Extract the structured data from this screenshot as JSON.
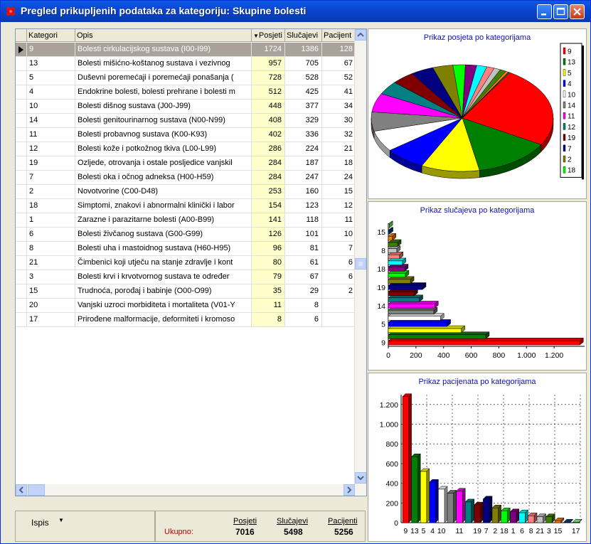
{
  "window": {
    "title": "Pregled prikupljenih podataka za kategoriju: Skupine bolesti"
  },
  "table": {
    "columns": {
      "kategorija": "Kategori",
      "opis": "Opis",
      "posjeti": "Posjeti",
      "slucajevi": "Slučajevi",
      "pacijenti": "Pacijent"
    },
    "rows": [
      {
        "kategorija": "9",
        "opis": "Bolesti cirkulacijskog sustava (I00-I99)",
        "posjeti": "1724",
        "slucajevi": "1386",
        "pacijenti": "128"
      },
      {
        "kategorija": "13",
        "opis": "Bolesti mišićno-koštanog sustava i vezivnog",
        "posjeti": "957",
        "slucajevi": "705",
        "pacijenti": "67"
      },
      {
        "kategorija": "5",
        "opis": "Duševni poremećaji i poremećaji ponašanja (",
        "posjeti": "728",
        "slucajevi": "528",
        "pacijenti": "52"
      },
      {
        "kategorija": "4",
        "opis": "Endokrine bolesti, bolesti prehrane i bolesti m",
        "posjeti": "512",
        "slucajevi": "425",
        "pacijenti": "41"
      },
      {
        "kategorija": "10",
        "opis": "Bolesti dišnog sustava (J00-J99)",
        "posjeti": "448",
        "slucajevi": "377",
        "pacijenti": "34"
      },
      {
        "kategorija": "14",
        "opis": "Bolesti genitourinarnog sustava (N00-N99)",
        "posjeti": "408",
        "slucajevi": "329",
        "pacijenti": "30"
      },
      {
        "kategorija": "11",
        "opis": "Bolesti probavnog sustava (K00-K93)",
        "posjeti": "402",
        "slucajevi": "336",
        "pacijenti": "32"
      },
      {
        "kategorija": "12",
        "opis": "Bolesti kože i potkožnog tkiva (L00-L99)",
        "posjeti": "286",
        "slucajevi": "224",
        "pacijenti": "21"
      },
      {
        "kategorija": "19",
        "opis": "Ozljede, otrovanja i ostale posljedice vanjskil",
        "posjeti": "284",
        "slucajevi": "187",
        "pacijenti": "18"
      },
      {
        "kategorija": "7",
        "opis": "Bolesti oka i očnog adneksa (H00-H59)",
        "posjeti": "284",
        "slucajevi": "247",
        "pacijenti": "24"
      },
      {
        "kategorija": "2",
        "opis": "Novotvorine (C00-D48)",
        "posjeti": "253",
        "slucajevi": "160",
        "pacijenti": "15"
      },
      {
        "kategorija": "18",
        "opis": "Simptomi, znakovi i abnormalni klinički i labor",
        "posjeti": "154",
        "slucajevi": "123",
        "pacijenti": "12"
      },
      {
        "kategorija": "1",
        "opis": "Zarazne i parazitarne bolesti (A00-B99)",
        "posjeti": "141",
        "slucajevi": "118",
        "pacijenti": "11"
      },
      {
        "kategorija": "6",
        "opis": "Bolesti živčanog sustava (G00-G99)",
        "posjeti": "126",
        "slucajevi": "101",
        "pacijenti": "10"
      },
      {
        "kategorija": "8",
        "opis": "Bolesti uha i mastoidnog sustava (H60-H95)",
        "posjeti": "96",
        "slucajevi": "81",
        "pacijenti": "7"
      },
      {
        "kategorija": "21",
        "opis": "Čimbenici koji utječu na stanje zdravlje i kont",
        "posjeti": "80",
        "slucajevi": "61",
        "pacijenti": "6"
      },
      {
        "kategorija": "3",
        "opis": "Bolesti krvi i krvotvornog sustava te određer",
        "posjeti": "79",
        "slucajevi": "67",
        "pacijenti": "6"
      },
      {
        "kategorija": "15",
        "opis": "Trudnoća, porođaj i babinje (O00-O99)",
        "posjeti": "35",
        "slucajevi": "29",
        "pacijenti": "2"
      },
      {
        "kategorija": "20",
        "opis": "Vanjski uzroci morbiditeta i mortaliteta (V01-Y",
        "posjeti": "11",
        "slucajevi": "8",
        "pacijenti": ""
      },
      {
        "kategorija": "17",
        "opis": "Prirođene malformacije, deformiteti i kromoso",
        "posjeti": "8",
        "slucajevi": "6",
        "pacijenti": ""
      }
    ]
  },
  "footer": {
    "ispis_label": "Ispis",
    "ukupno_label": "Ukupno:",
    "posjeti_label": "Posjeti",
    "posjeti_value": "7016",
    "slucajevi_label": "Slučajevi",
    "slucajevi_value": "5498",
    "pacijenti_label": "Pacijenti",
    "pacijenti_value": "5256"
  },
  "colors": {
    "9": "#ff0000",
    "13": "#008000",
    "5": "#ffff00",
    "4": "#0000ff",
    "10": "#ffffff",
    "14": "#808080",
    "11": "#ff00ff",
    "12": "#008080",
    "19": "#800000",
    "7": "#000080",
    "2": "#808000",
    "18": "#00ff00",
    "1": "#800080",
    "6": "#00ffff",
    "8": "#ff8080",
    "21": "#c0c0c0",
    "3": "#408000",
    "15": "#ff8000",
    "20": "#004080",
    "17": "#80ff80"
  },
  "chart_data": [
    {
      "type": "pie",
      "title": "Prikaz posjeta po kategorijama",
      "categories": [
        "9",
        "13",
        "5",
        "4",
        "10",
        "14",
        "11",
        "12",
        "19",
        "7",
        "2",
        "18",
        "1",
        "6",
        "8",
        "21",
        "3",
        "15",
        "20",
        "17"
      ],
      "values": [
        1724,
        957,
        728,
        512,
        448,
        408,
        402,
        286,
        284,
        284,
        253,
        154,
        141,
        126,
        96,
        80,
        79,
        35,
        11,
        8
      ],
      "legend": [
        "9",
        "13",
        "5",
        "4",
        "10",
        "14",
        "11",
        "12",
        "19",
        "7",
        "2",
        "18"
      ]
    },
    {
      "type": "bar",
      "orientation": "horizontal",
      "title": "Prikaz slučajeva po kategorijama",
      "categories": [
        "9",
        "13",
        "5",
        "4",
        "10",
        "14",
        "11",
        "12",
        "19",
        "7",
        "2",
        "18",
        "1",
        "6",
        "8",
        "21",
        "3",
        "15",
        "20",
        "17"
      ],
      "values": [
        1386,
        705,
        528,
        425,
        377,
        329,
        336,
        224,
        187,
        247,
        160,
        123,
        118,
        101,
        81,
        61,
        67,
        29,
        8,
        6
      ],
      "y_tick_labels": [
        "9",
        "5",
        "14",
        "19",
        "18",
        "8",
        "15"
      ],
      "x_tick_labels": [
        "0",
        "200",
        "400",
        "600",
        "800",
        "1.000",
        "1.200"
      ],
      "xlim": [
        0,
        1400
      ]
    },
    {
      "type": "bar",
      "title": "Prikaz pacijenata po kategorijama",
      "categories": [
        "9",
        "13",
        "5",
        "4",
        "10",
        "14",
        "11",
        "12",
        "19",
        "7",
        "2",
        "18",
        "1",
        "6",
        "8",
        "21",
        "3",
        "15",
        "20",
        "17"
      ],
      "values": [
        1280,
        670,
        520,
        410,
        340,
        300,
        320,
        210,
        180,
        240,
        150,
        120,
        110,
        100,
        70,
        60,
        60,
        20,
        5,
        5
      ],
      "x_tick_labels": [
        "9",
        "13",
        "5",
        "4",
        "10",
        "11",
        "19",
        "7",
        "2",
        "18",
        "1",
        "6",
        "8",
        "21",
        "3",
        "15",
        "17"
      ],
      "y_tick_labels": [
        "0",
        "200",
        "400",
        "600",
        "800",
        "1.000",
        "1.200"
      ],
      "ylim": [
        0,
        1300
      ]
    }
  ]
}
